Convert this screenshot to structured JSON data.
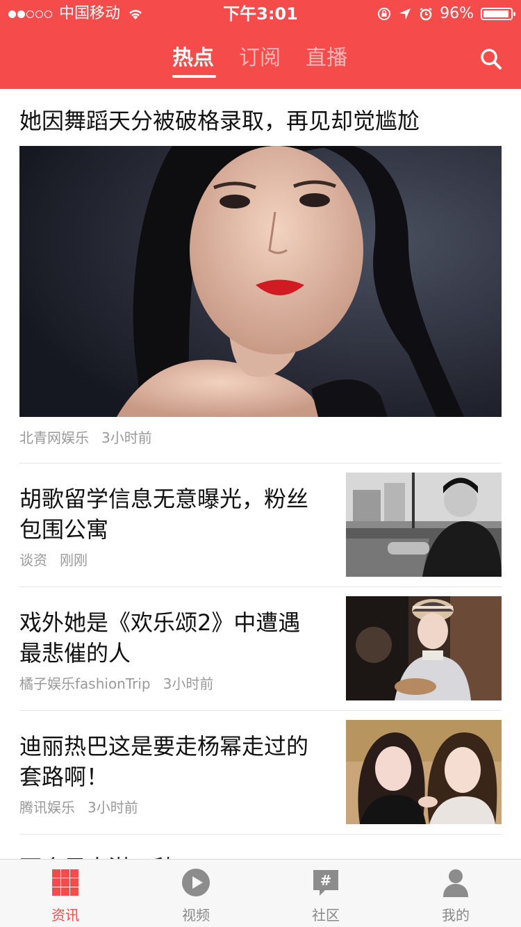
{
  "status_bar": {
    "carrier": "中国移动",
    "time": "下午3:01",
    "battery_percent": "96%",
    "battery_level": 0.96
  },
  "top_nav": {
    "tabs": [
      {
        "label": "热点",
        "active": true
      },
      {
        "label": "订阅",
        "active": false
      },
      {
        "label": "直播",
        "active": false
      }
    ],
    "search_icon": "search-icon"
  },
  "feed": {
    "featured": {
      "title": "她因舞蹈天分被破格录取，再见却觉尴尬",
      "source": "北青网娱乐",
      "time": "3小时前"
    },
    "items": [
      {
        "title_line1": "胡歌留学信息无意曝光，粉丝",
        "title_line2": "包围公寓",
        "source": "谈资",
        "time": "刚刚"
      },
      {
        "title_line1": "戏外她是《欢乐颂2》中遭遇",
        "title_line2": "最悲催的人",
        "source": "橘子娱乐fashionTrip",
        "time": "3小时前"
      },
      {
        "title_line1": "迪丽热巴这是要走杨幂走过的",
        "title_line2": "套路啊！",
        "source": "腾讯娱乐",
        "time": "3小时前"
      }
    ],
    "partial_next_title": "两个男人湛一种"
  },
  "tab_bar": {
    "items": [
      {
        "label": "资讯",
        "icon": "grid-icon",
        "active": true
      },
      {
        "label": "视频",
        "icon": "play-icon",
        "active": false
      },
      {
        "label": "社区",
        "icon": "hashtag-chat-icon",
        "active": false
      },
      {
        "label": "我的",
        "icon": "person-icon",
        "active": false
      }
    ]
  },
  "colors": {
    "accent": "#f64b4b",
    "text_primary": "#111111",
    "text_meta": "#999999",
    "tab_inactive": "#888888"
  }
}
